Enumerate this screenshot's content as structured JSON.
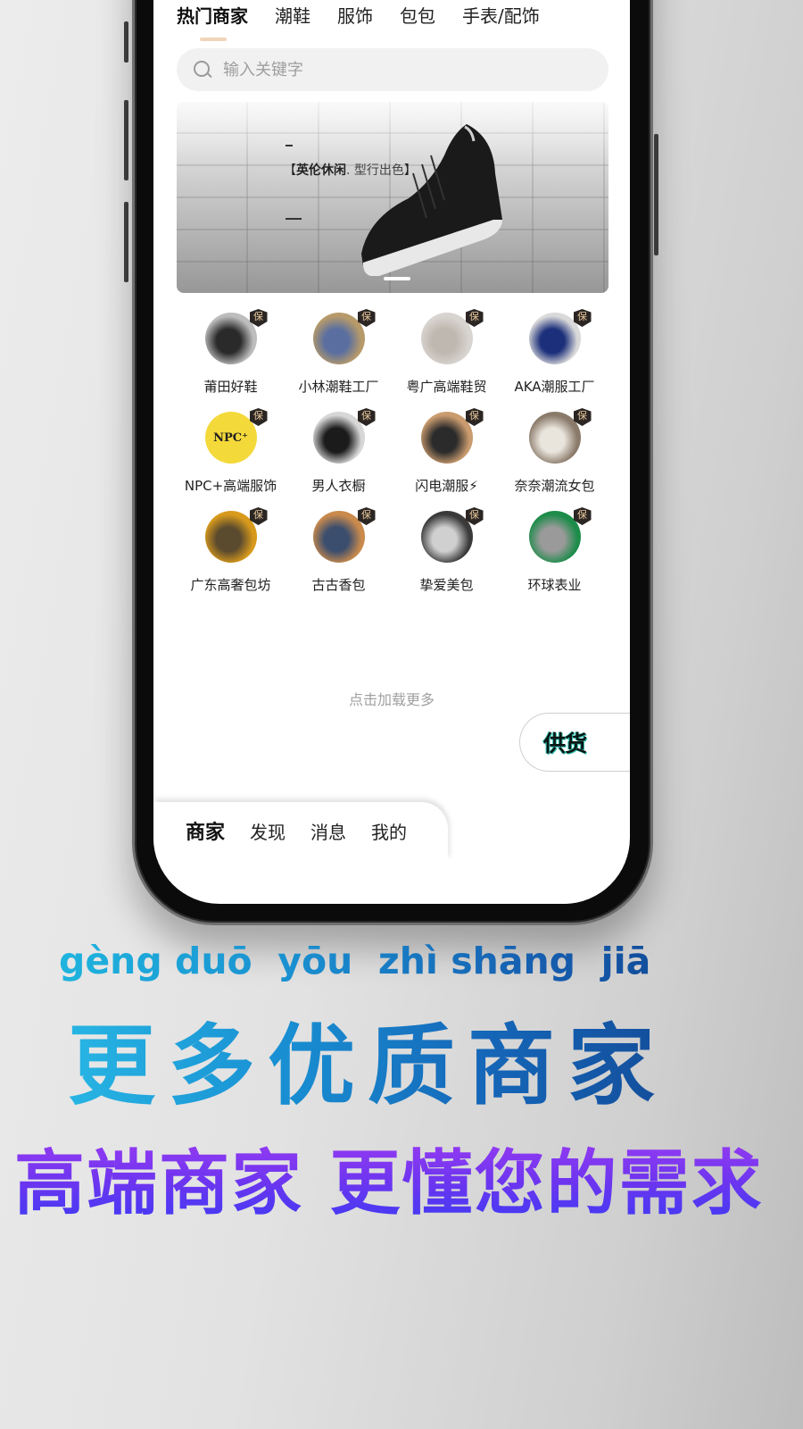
{
  "top_tabs": [
    {
      "label": "热门商家",
      "active": true
    },
    {
      "label": "潮鞋",
      "active": false
    },
    {
      "label": "服饰",
      "active": false
    },
    {
      "label": "包包",
      "active": false
    },
    {
      "label": "手表/配饰",
      "active": false
    }
  ],
  "search": {
    "placeholder": "输入关键字",
    "value": "",
    "icon": "search-icon"
  },
  "banner": {
    "title_bold": "英伦休闲",
    "title_thin": ". 型行出色",
    "bracket_left": "【",
    "bracket_right": "】",
    "slides": 1,
    "active_slide": 1
  },
  "badge_label": "保",
  "merchants": [
    {
      "name": "莆田好鞋",
      "avatar_colors": [
        "#bdbdbd",
        "#2a2a2a"
      ]
    },
    {
      "name": "小林潮鞋工厂",
      "avatar_colors": [
        "#b79a6a",
        "#5a6fa0"
      ]
    },
    {
      "name": "粤广高端鞋贸",
      "avatar_colors": [
        "#d8d4d0",
        "#bfb8b0"
      ]
    },
    {
      "name": "AKA潮服工厂",
      "avatar_colors": [
        "#d9d9d9",
        "#1c2f7a"
      ]
    },
    {
      "name": "NPC+高端服饰",
      "avatar_colors": [
        "#f4d93a",
        "#222222"
      ],
      "avatar_text": "NPC⁺"
    },
    {
      "name": "男人衣橱",
      "avatar_colors": [
        "#d7d7d7",
        "#1b1b1b"
      ]
    },
    {
      "name": "闪电潮服⚡",
      "avatar_colors": [
        "#c99b6e",
        "#2b2b2b"
      ]
    },
    {
      "name": "奈奈潮流女包",
      "avatar_colors": [
        "#8a7a6a",
        "#e9e4dc"
      ]
    },
    {
      "name": "广东高奢包坊",
      "avatar_colors": [
        "#d89a1c",
        "#5a4a2e"
      ]
    },
    {
      "name": "古古香包",
      "avatar_colors": [
        "#c98a4c",
        "#3c4e6e"
      ]
    },
    {
      "name": "挚爱美包",
      "avatar_colors": [
        "#3a3a3a",
        "#d0d0d0"
      ]
    },
    {
      "name": "环球表业",
      "avatar_colors": [
        "#1d8c4a",
        "#9a9a9a"
      ]
    }
  ],
  "load_more": "点击加载更多",
  "supply_button": "供货",
  "bottom_nav": [
    {
      "label": "商家",
      "active": true
    },
    {
      "label": "发现",
      "active": false
    },
    {
      "label": "消息",
      "active": false
    },
    {
      "label": "我的",
      "active": false
    }
  ],
  "promo": {
    "pinyin": "gèng duō  yōu  zhì shāng  jiā",
    "headline": "更多优质商家",
    "subheadline": "高端商家 更懂您的需求"
  },
  "colors": {
    "tab_indicator": "#f2d4b9",
    "badge_bg": "#2b2623",
    "badge_text": "#e8c79c",
    "headline_blue": "#1990d3",
    "subheadline_purple": "#6d35f0"
  }
}
